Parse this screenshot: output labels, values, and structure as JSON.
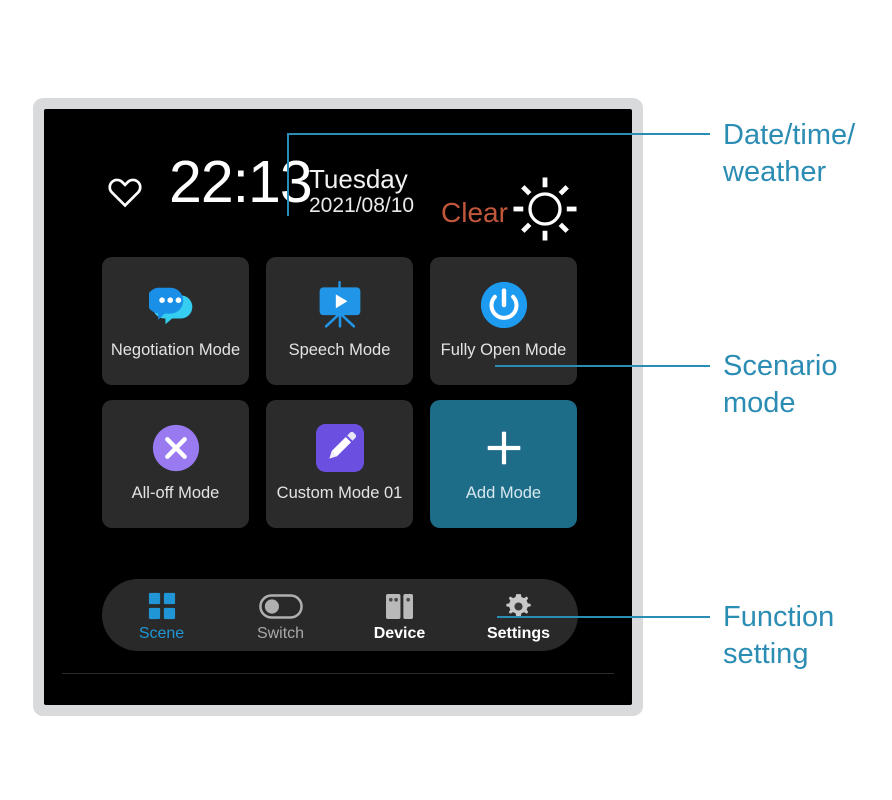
{
  "device": {
    "status_bar": {
      "favorite_icon": "heart-icon",
      "time": "22:13",
      "weekday": "Tuesday",
      "date": "2021/08/10",
      "weather_text": "Clear",
      "weather_icon": "sun-icon",
      "weather_text_color": "#c2573c"
    },
    "scenario_modes": [
      {
        "label": "Negotiation Mode",
        "icon": "chat-bubbles-icon",
        "accent": false
      },
      {
        "label": "Speech Mode",
        "icon": "projector-play-icon",
        "accent": false
      },
      {
        "label": "Fully Open Mode",
        "icon": "power-icon",
        "accent": false
      },
      {
        "label": "All-off Mode",
        "icon": "close-circle-icon",
        "accent": false
      },
      {
        "label": "Custom Mode 01",
        "icon": "pencil-icon",
        "accent": false
      },
      {
        "label": "Add Mode",
        "icon": "plus-icon",
        "accent": true
      }
    ],
    "bottom_nav": [
      {
        "label": "Scene",
        "icon": "grid-icon",
        "state": "active"
      },
      {
        "label": "Switch",
        "icon": "toggle-off-icon",
        "state": "inactive"
      },
      {
        "label": "Device",
        "icon": "switch-panels-icon",
        "state": "bold"
      },
      {
        "label": "Settings",
        "icon": "gear-icon",
        "state": "bold"
      }
    ]
  },
  "annotations": [
    {
      "text": "Date/time/\nweather"
    },
    {
      "text": "Scenario\nmode"
    },
    {
      "text": "Function\nsetting"
    }
  ],
  "colors": {
    "accent_blue": "#2196d6",
    "annotation_blue": "#2b8cb4",
    "tile_bg": "#2b2b2b",
    "tile_accent_bg": "#1d6c88",
    "bezel": "#d9dadc",
    "screen_bg": "#000000"
  }
}
